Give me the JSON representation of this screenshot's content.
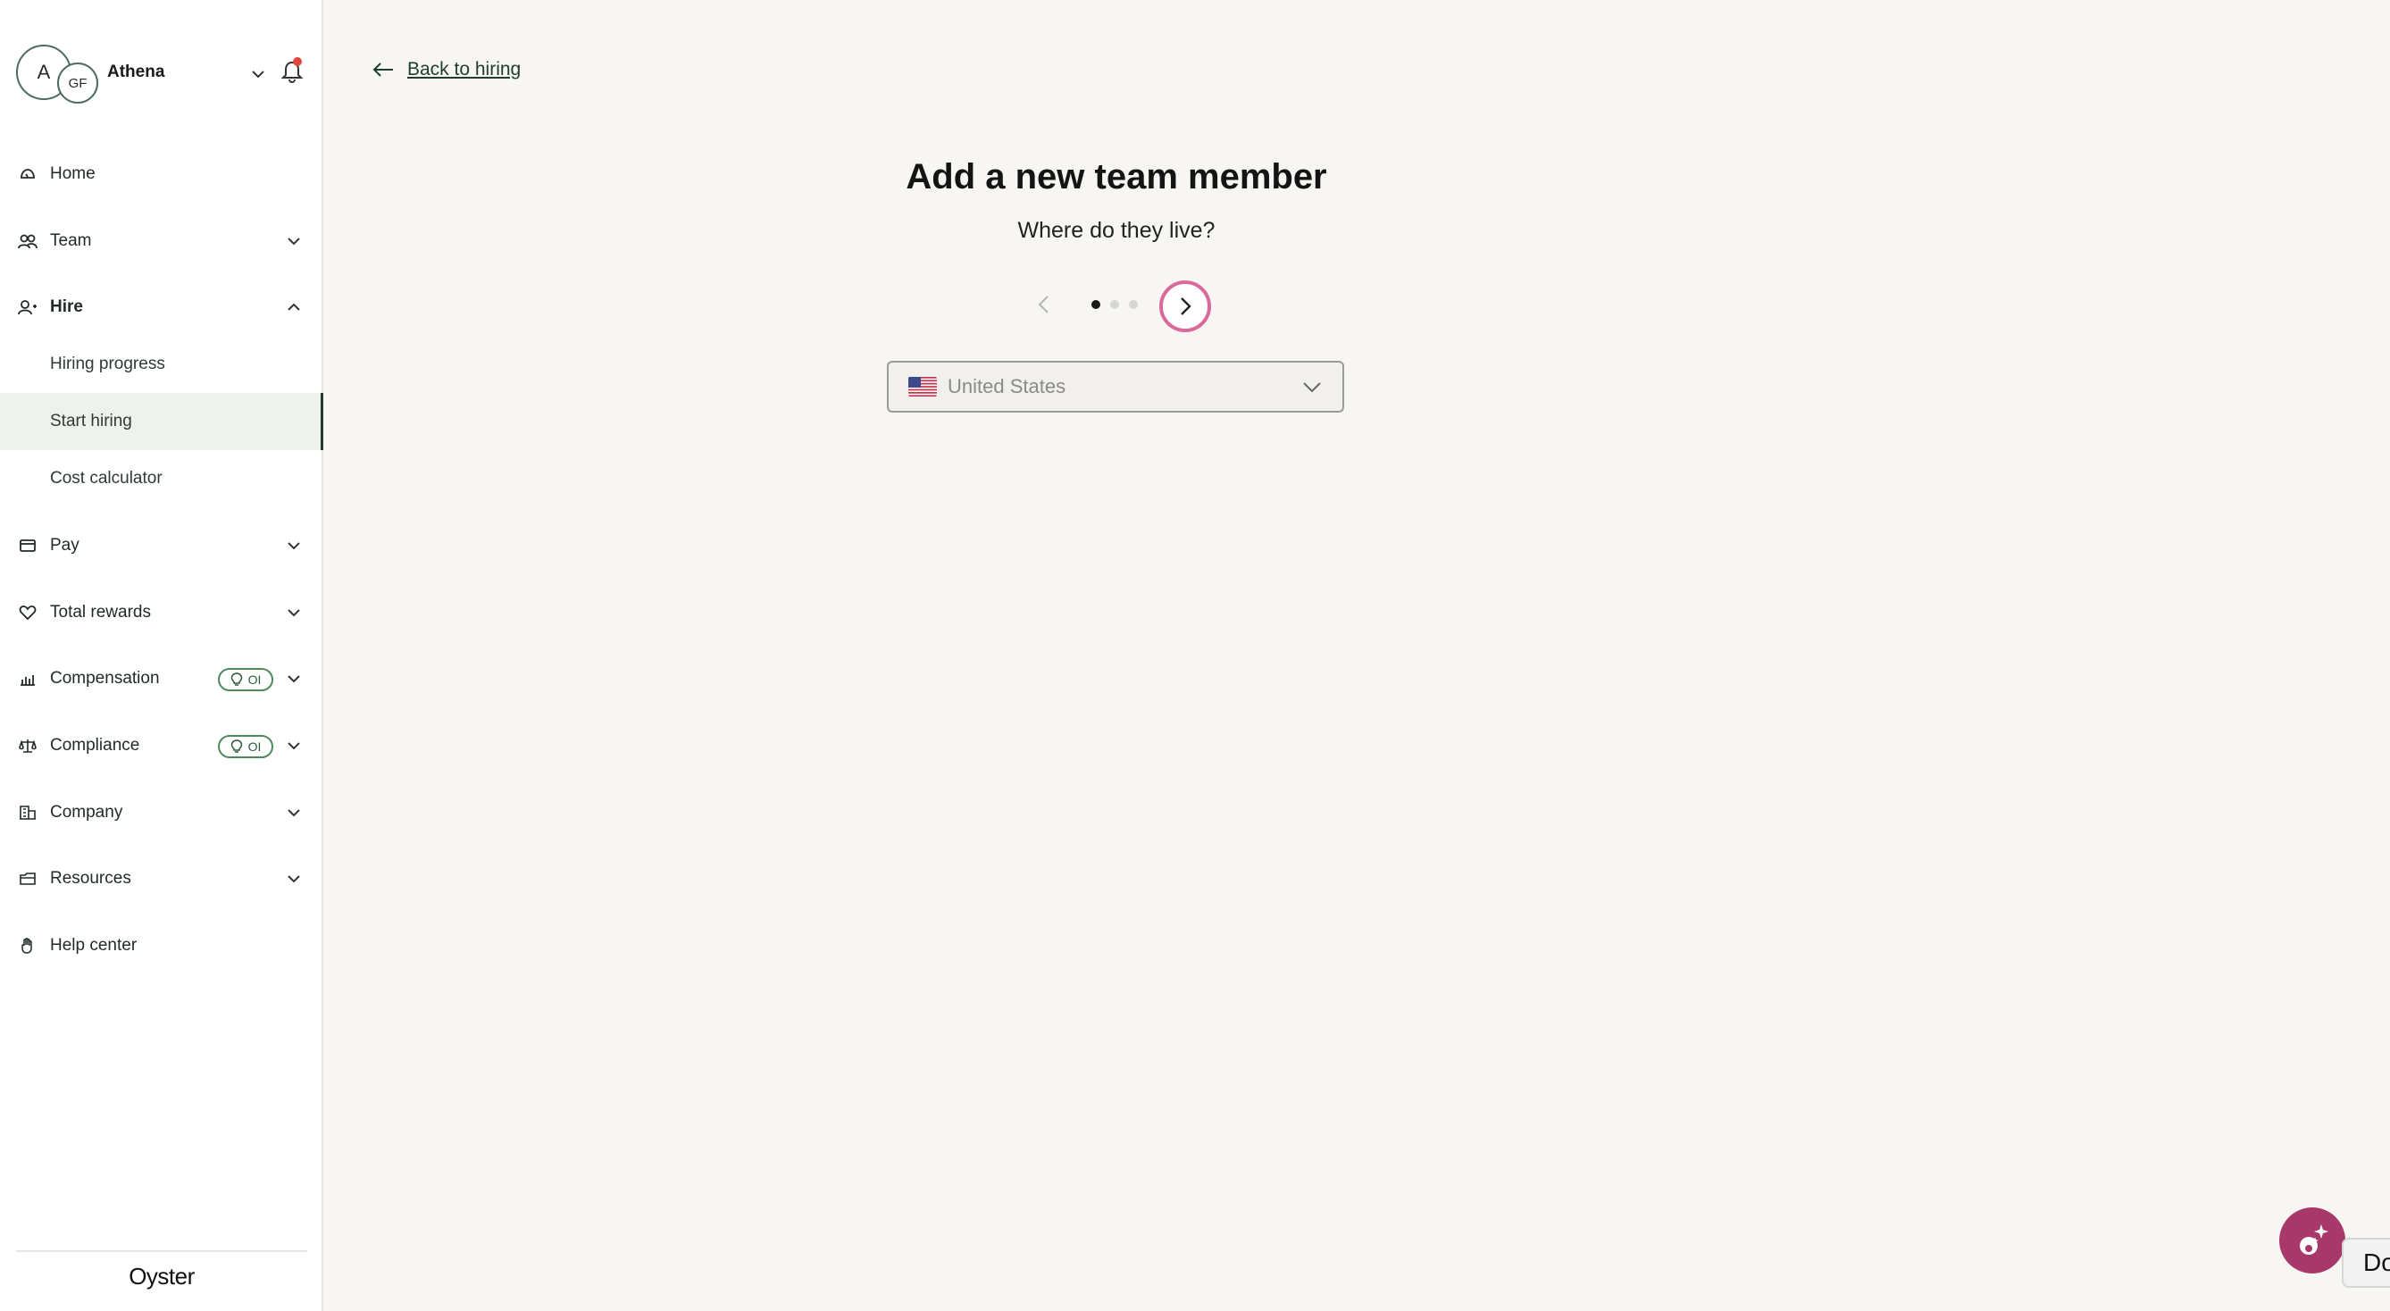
{
  "account": {
    "avatar_initial": "A",
    "org_initials": "GF",
    "name": "Athena"
  },
  "sidebar": {
    "items": [
      {
        "label": "Home",
        "icon": "home-icon"
      },
      {
        "label": "Team",
        "icon": "team-icon"
      },
      {
        "label": "Hire",
        "icon": "hire-icon"
      },
      {
        "label": "Pay",
        "icon": "pay-icon"
      },
      {
        "label": "Total rewards",
        "icon": "heart-icon"
      },
      {
        "label": "Compensation",
        "icon": "chart-icon",
        "badge": "OI"
      },
      {
        "label": "Compliance",
        "icon": "scale-icon",
        "badge": "OI"
      },
      {
        "label": "Company",
        "icon": "building-icon"
      },
      {
        "label": "Resources",
        "icon": "folder-icon"
      },
      {
        "label": "Help center",
        "icon": "hand-icon"
      }
    ],
    "hire_subitems": [
      {
        "label": "Hiring progress"
      },
      {
        "label": "Start hiring",
        "active": true
      },
      {
        "label": "Cost calculator"
      }
    ],
    "logo": "Oyster"
  },
  "main": {
    "back_label": "Back to hiring",
    "title": "Add a new team member",
    "subtitle": "Where do they live?",
    "steps": {
      "current": 1,
      "total": 3
    },
    "country_select": {
      "value": "United States"
    }
  },
  "edge_tab": "Do",
  "colors": {
    "accent": "#1f3b2e",
    "next_ring": "#d96a9a",
    "assistant": "#a8386a",
    "notification_dot": "#e0463d"
  }
}
